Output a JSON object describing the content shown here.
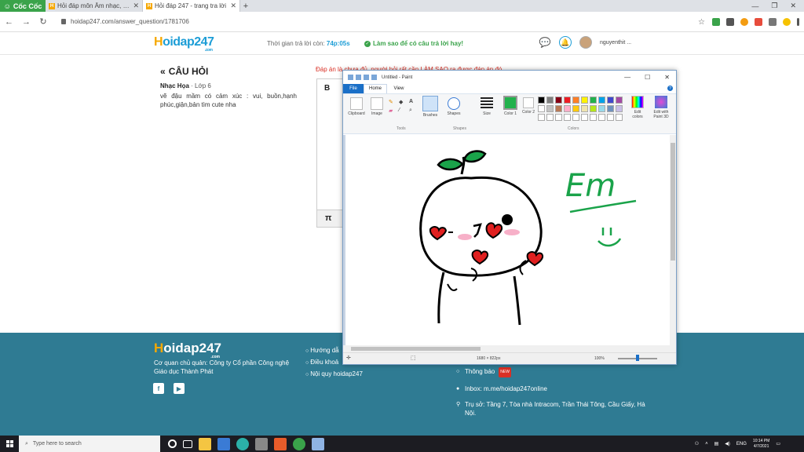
{
  "browser": {
    "brand_label": "Cốc Cốc",
    "tabs": [
      {
        "title": "Hỏi đáp môn Âm nhạc, Mỹ thuật"
      },
      {
        "title": "Hỏi đáp 247 - trang tra lời"
      }
    ],
    "url": "hoidap247.com/answer_question/1781706"
  },
  "header": {
    "logo_main": "oidap247",
    "logo_h": "H",
    "logo_com": ".com",
    "timer_label": "Thời gian trả lời còn:",
    "timer_value": "74p:05s",
    "howto_label": "Làm sao để có câu trả lời hay!",
    "username": "nguyenthit ..."
  },
  "question": {
    "title": "CÂU HỎI",
    "subject": "Nhạc Họa",
    "grade": "· Lớp 6",
    "body": "vẽ đậu mầm có cảm xúc : vui, buồn,hạnh phúc,giận,bản tìm cute nha"
  },
  "answer": {
    "note": "Đáp án là chưa đủ, người hỏi rất cần LÀM SAO ra được đáp án đó.",
    "bold_btn": "B",
    "pi_btn": "π"
  },
  "paint": {
    "title": "Untitled - Paint",
    "menu": {
      "file": "File",
      "home": "Home",
      "view": "View"
    },
    "ribbon": {
      "clipboard": "Clipboard",
      "image": "Image",
      "tools": "Tools",
      "brushes": "Brushes",
      "shapes_btn": "Shapes",
      "shapes_group": "Shapes",
      "size": "Size",
      "color1": "Color 1",
      "color2": "Color 2",
      "colors_group": "Colors",
      "edit_colors": "Edit colors",
      "edit_paint3d": "Edit with Paint 3D"
    },
    "palette": [
      "#000000",
      "#7f7f7f",
      "#880015",
      "#ed1c24",
      "#ff7f27",
      "#fff200",
      "#22b14c",
      "#00a2e8",
      "#3f48cc",
      "#a349a4",
      "#ffffff",
      "#c3c3c3",
      "#b97a57",
      "#ffaec9",
      "#ffc90e",
      "#efe4b0",
      "#b5e61d",
      "#99d9ea",
      "#7092be",
      "#c8bfe7",
      "#ffffff",
      "#ffffff",
      "#ffffff",
      "#ffffff",
      "#ffffff",
      "#ffffff",
      "#ffffff",
      "#ffffff",
      "#ffffff",
      "#ffffff"
    ],
    "primary_color": "#22b14c",
    "canvas_text": "Em",
    "status_dims": "1680 × 822px",
    "zoom": "100%"
  },
  "footer": {
    "logo_main": "oidap247",
    "logo_h": "H",
    "company": "Cơ quan chủ quản: Công ty Cổ phần Công nghệ Giáo dục Thành Phát",
    "links": [
      "Hướng dẫ",
      "Điều khoả",
      "Nội quy hoidap247"
    ],
    "notice": "Thông báo",
    "notice_badge": "NEW",
    "inbox": "Inbox: m.me/hoidap247online",
    "address": "Trụ sở: Tầng 7, Tòa nhà Intracom, Trần Thái Tông, Cầu Giấy, Hà Nội."
  },
  "taskbar": {
    "search_placeholder": "Type here to search",
    "lang": "ENG",
    "time": "10:14 PM",
    "date": "4/7/2021"
  },
  "colors": {
    "site_blue": "#1c9dd6",
    "footer_bg": "#2f7b93",
    "brand_green": "#3aa34a",
    "accent_orange": "#f6a800"
  }
}
